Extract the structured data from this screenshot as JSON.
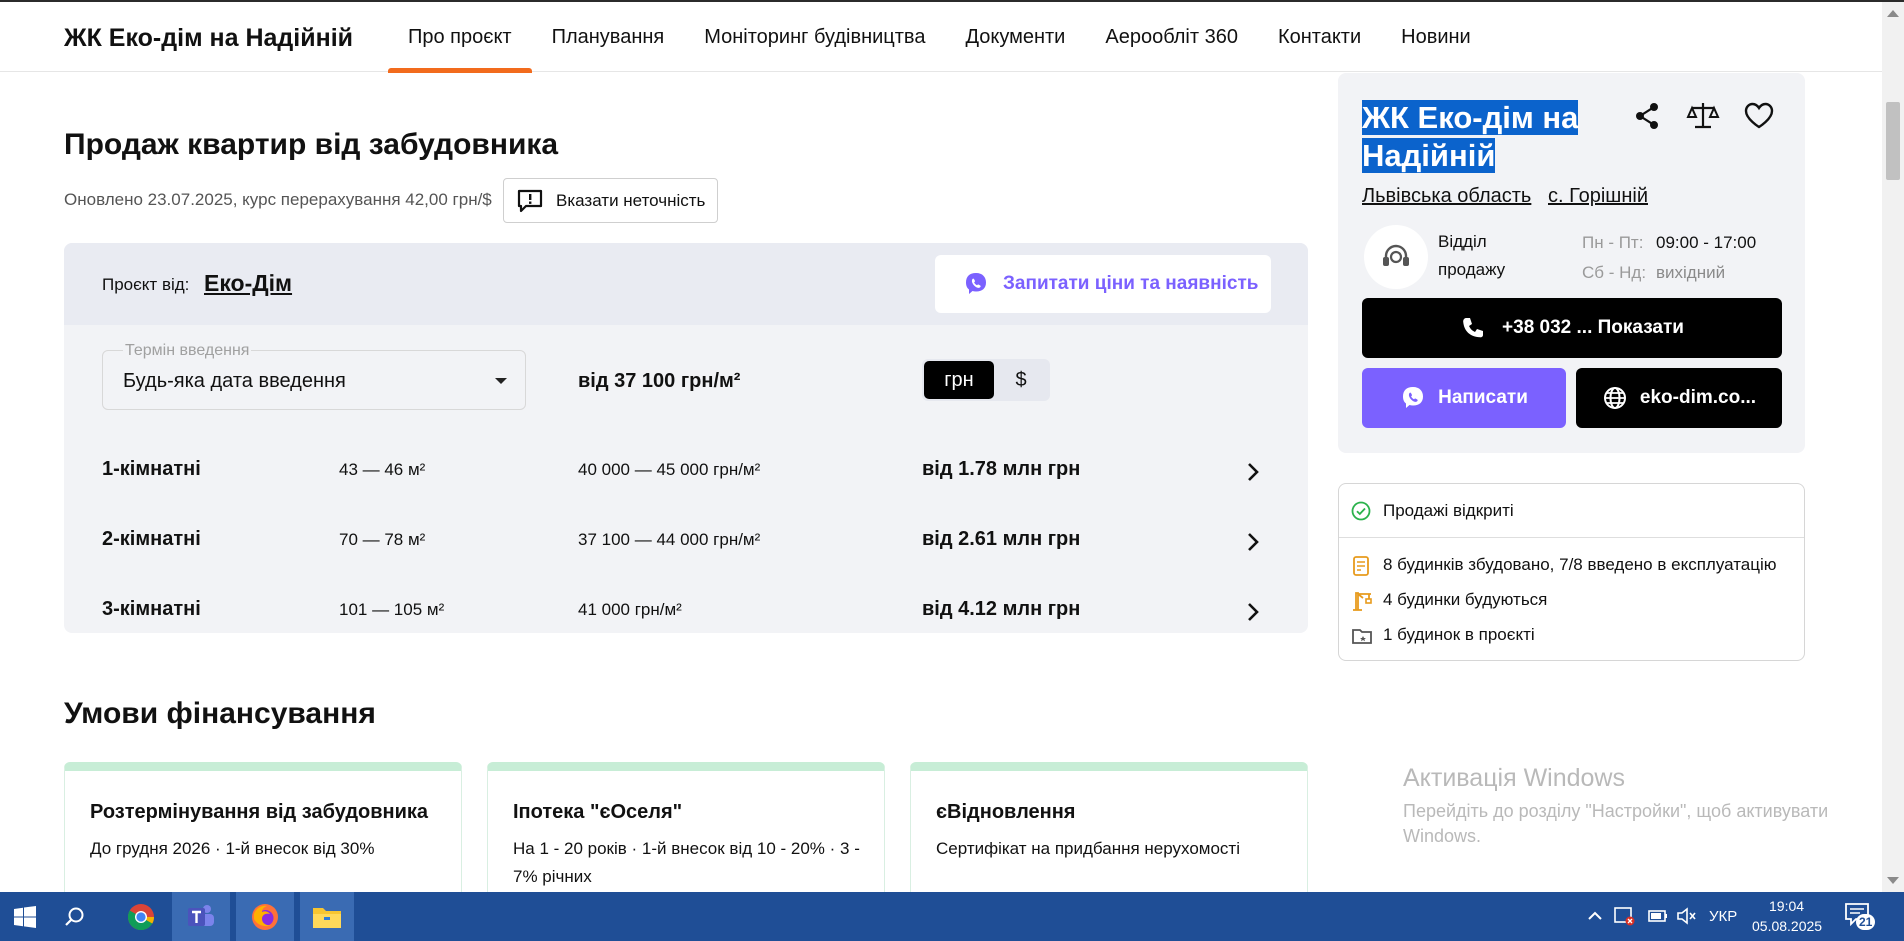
{
  "header": {
    "brand": "ЖК Еко-дім на Надійній",
    "nav": [
      "Про проєкт",
      "Планування",
      "Моніторинг будівництва",
      "Документи",
      "Аерообліт 360",
      "Контакти",
      "Новини"
    ],
    "active_nav": "Про проєкт",
    "accent_color": "#f26b1d"
  },
  "main": {
    "title": "Продаж квартир від забудовника",
    "updated": "Оновлено 23.07.2025, курс перерахування 42,00 грн/$",
    "report_button": "Вказати неточність",
    "project_by_label": "Проєкт від:",
    "developer": "Еко-Дім",
    "ask_button": "Запитати ціни та наявність",
    "term_label": "Термін введення",
    "term_value": "Будь-яка дата введення",
    "from_price": "від 37 100 грн/м²",
    "currency_uah": "грн",
    "currency_usd": "$",
    "rows": [
      {
        "rooms": "1-кімнатні",
        "area": "43 — 46 м²",
        "price_m2": "40 000 — 45 000 грн/м²",
        "total": "від 1.78 млн грн"
      },
      {
        "rooms": "2-кімнатні",
        "area": "70 — 78 м²",
        "price_m2": "37 100 — 44 000 грн/м²",
        "total": "від 2.61 млн грн"
      },
      {
        "rooms": "3-кімнатні",
        "area": "101 — 105 м²",
        "price_m2": "41 000 грн/м²",
        "total": "від 4.12 млн грн"
      }
    ],
    "finance_title": "Умови фінансування",
    "finance_cards": [
      {
        "title": "Розтермінування від забудовника",
        "desc": "До грудня 2026 · 1-й внесок від 30%"
      },
      {
        "title": "Іпотека \"єОселя\"",
        "desc": "На 1 - 20 років · 1-й внесок від 10 - 20% · 3 - 7% річних"
      },
      {
        "title": "єВідновлення",
        "desc": "Сертифікат на придбання нерухомості"
      }
    ]
  },
  "sidebar": {
    "title_line1": "ЖК Еко-дім на",
    "title_line2": "Надійній",
    "region": "Львівська область",
    "village": "с. Горішній",
    "dept_line1": "Відділ",
    "dept_line2": "продажу",
    "weekdays_label": "Пн - Пт:",
    "weekdays_value": "09:00 - 17:00",
    "weekend_label": "Сб - Нд:",
    "weekend_value": "вихідний",
    "phone_button": "+38 032 ... Показати",
    "write_button": "Написати",
    "site_button": "eko-dim.co...",
    "viber_color": "#7b61ff"
  },
  "status": {
    "sales_open": "Продажі відкриті",
    "built": "8 будинків збудовано, 7/8 введено в експлуатацію",
    "building": "4 будинки будуються",
    "project": "1 будинок в проєкті"
  },
  "watermark": {
    "line1": "Активація Windows",
    "line2": "Перейдіть до розділу \"Настройки\", щоб активувати Windows."
  },
  "taskbar": {
    "language": "УКР",
    "time": "19:04",
    "date": "05.08.2025",
    "notifications": "21"
  }
}
